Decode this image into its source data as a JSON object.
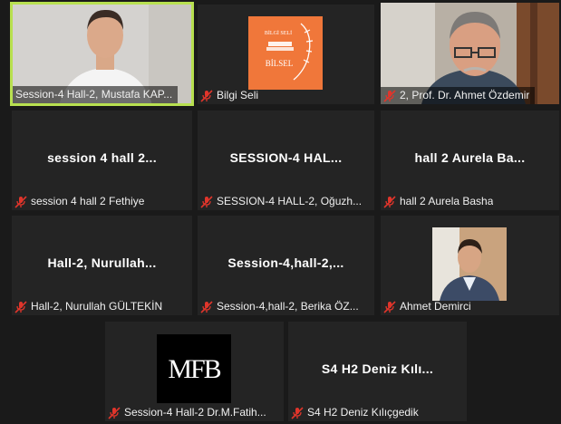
{
  "participants": [
    {
      "center": "",
      "label": "Session-4 Hall-2, Mustafa KAP...",
      "video": "person-video"
    },
    {
      "center": "",
      "label": "Bilgi Seli",
      "video": "bilgi-seli-logo",
      "logo_top": "BİLGİ SELİ",
      "logo_mid": "BİLSEL"
    },
    {
      "center": "",
      "label": "2, Prof. Dr. Ahmet Özdemir",
      "video": "person-video"
    },
    {
      "center": "session 4 hall 2...",
      "label": "session 4 hall 2 Fethiye"
    },
    {
      "center": "SESSION-4  HAL...",
      "label": "SESSION-4 HALL-2, Oğuzh..."
    },
    {
      "center": "hall 2 Aurela Ba...",
      "label": "hall 2 Aurela Basha"
    },
    {
      "center": "Hall-2,  Nurullah...",
      "label": "Hall-2, Nurullah GÜLTEKİN"
    },
    {
      "center": "Session-4,hall-2,...",
      "label": "Session-4,hall-2, Berika ÖZ..."
    },
    {
      "center": "",
      "label": "Ahmet Demirci",
      "video": "person-video"
    },
    {
      "center": "",
      "label": "Session-4 Hall-2 Dr.M.Fatih...",
      "video": "mfb-logo",
      "logo_text": "MFB"
    },
    {
      "center": "S4  H2  Deniz Kılı...",
      "label": "S4 H2 Deniz Kılıçgedik"
    }
  ],
  "icons": {
    "muted": "mic-muted-icon"
  },
  "colors": {
    "active_border": "#b8e050",
    "mute_red": "#e0352b",
    "tile_bg": "#242424"
  }
}
